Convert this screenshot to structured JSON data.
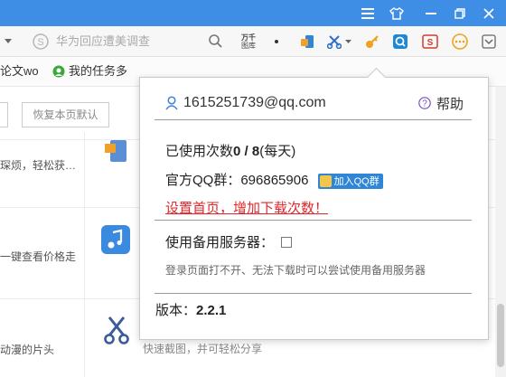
{
  "toolbar": {
    "search_hint": "华为回应遭美调查",
    "wanqian_label_top": "万千",
    "wanqian_label_bottom": "图库"
  },
  "bookmarks": {
    "item1": "论文wo",
    "item2": "我的任务多"
  },
  "page": {
    "restore_button": "恢复本页默认",
    "snippet1": "琛烦，轻松获…",
    "snippet2": "一键查看价格走",
    "snippet3": "动漫的片头",
    "snippet4": "快速截图，并可轻松分享"
  },
  "popup": {
    "account": "1615251739@qq.com",
    "help": "帮助",
    "usage_prefix": "已使用次数",
    "usage_used": "0",
    "usage_sep": " / ",
    "usage_total": "8",
    "usage_suffix": "(每天)",
    "qq_group_label": "官方QQ群：",
    "qq_group_number": "696865906",
    "join_qq_group": "加入QQ群",
    "set_homepage_link": "设置首页，增加下载次数！",
    "backup_server_label": "使用备用服务器：",
    "backup_server_checked": false,
    "backup_hint": "登录页面打不开、无法下载时可以尝试使用备用服务器",
    "version_label": "版本：",
    "version_value": "2.2.1"
  },
  "colors": {
    "titlebar": "#3e8ee6",
    "link_red": "#e0272b",
    "qq_button": "#2f86d6"
  }
}
